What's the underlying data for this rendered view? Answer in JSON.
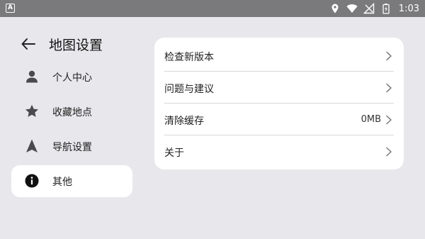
{
  "status_bar": {
    "app_badge": "A",
    "time": "1:03"
  },
  "header": {
    "title": "地图设置"
  },
  "sidebar": {
    "items": [
      {
        "label": "个人中心",
        "icon": "person-icon"
      },
      {
        "label": "收藏地点",
        "icon": "star-icon"
      },
      {
        "label": "导航设置",
        "icon": "navigation-arrow-icon"
      },
      {
        "label": "其他",
        "icon": "info-icon",
        "active": true
      }
    ]
  },
  "settings": {
    "rows": [
      {
        "label": "检查新版本"
      },
      {
        "label": "问题与建议"
      },
      {
        "label": "清除缓存",
        "value": "0MB"
      },
      {
        "label": "关于"
      }
    ]
  },
  "colors": {
    "background": "#e8e8ec",
    "status_bar": "#7a7a7c",
    "card": "#ffffff"
  }
}
